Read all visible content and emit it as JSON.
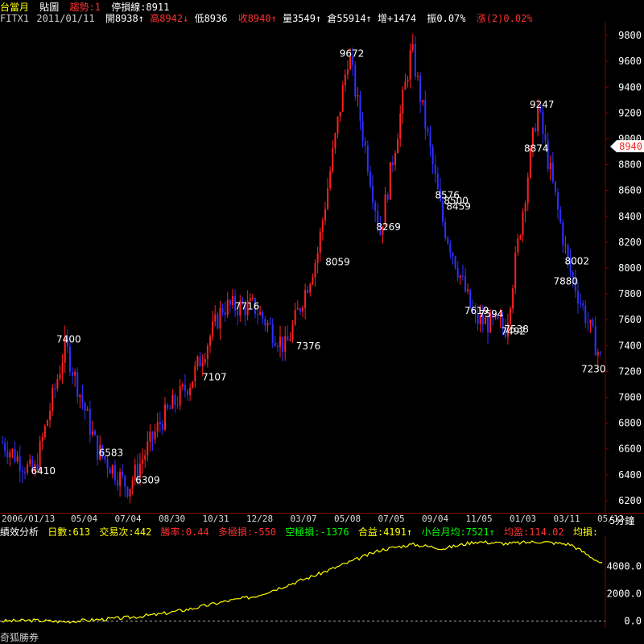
{
  "header": {
    "title": "台當月",
    "tab_chart": "貼圖",
    "trend": "趨勢:1",
    "stop": "停損線:8911"
  },
  "quote": {
    "symbol": "FITX1",
    "date": "2011/01/11",
    "open": "開8938↑",
    "high": "高8942↓",
    "low": "低8936",
    "close": "收8940↑",
    "volume": "量3549↑",
    "oi": "倉55914↑",
    "oi_change": "增+1474",
    "amplitude": "振0.07%",
    "change": "漲(2)0.02%"
  },
  "colors": {
    "up": "#ff2020",
    "down": "#3030ff",
    "yellow": "#ffff00",
    "green": "#00ff00",
    "red_label": "#ff3030",
    "axis": "#8b0000"
  },
  "price_axis": {
    "ticks": [
      "9800",
      "9600",
      "9400",
      "9200",
      "9000",
      "8800",
      "8600",
      "8400",
      "8200",
      "8000",
      "7800",
      "7600",
      "7400",
      "7200",
      "7000",
      "6800",
      "6600",
      "6400",
      "6200"
    ],
    "current_marker": "8940"
  },
  "timeframe": "5分鐘",
  "date_axis": [
    "2006/01/13",
    "05/04",
    "07/04",
    "08/30",
    "10/31",
    "12/28",
    "03/07",
    "05/08",
    "07/05",
    "09/04",
    "11/05",
    "01/03",
    "03/11",
    "05/12"
  ],
  "performance": {
    "label": "績效分析",
    "days": "日數:613",
    "trades": "交易次:442",
    "win_rate": "勝率:0.44",
    "long_loss": "多極損:-550",
    "short_loss": "空極損:-1376",
    "total_profit": "合益:4191↑",
    "mini_avg": "小台月均:7521↑",
    "avg_profit": "均盈:114.02",
    "avg_loss": "均損:"
  },
  "equity_axis": [
    "4000.0",
    "2000.0",
    "0.0"
  ],
  "footer": {
    "brand": "奇狐勝券"
  },
  "chart_data": [
    {
      "type": "line",
      "title": "",
      "xlabel": "",
      "ylabel": "",
      "ylim": [
        6100,
        9900
      ],
      "x": [
        "2006/01/13",
        "05/04",
        "07/04",
        "08/30",
        "10/31",
        "12/28",
        "03/07",
        "05/08",
        "07/05",
        "09/04",
        "11/05",
        "01/03",
        "03/11",
        "05/12",
        ""
      ],
      "series": [
        {
          "values": [
            6650,
            6400,
            7400,
            6600,
            6300,
            6800,
            7130,
            7700,
            7700,
            7380,
            8100,
            9670,
            8270,
            9700,
            8350,
            7600,
            7540,
            9250,
            8000,
            7300
          ]
        }
      ],
      "annotations": [
        "7400",
        "6410",
        "6583",
        "6309",
        "7376",
        "9672",
        "8269",
        "8500",
        "8059",
        "8874",
        "9247",
        "7538",
        "7594",
        "7880",
        "8576",
        "8002",
        "8459",
        "7716",
        "7619",
        "7492",
        "7230",
        "7107"
      ]
    },
    {
      "type": "line",
      "title": "",
      "ylim": [
        -500,
        6200
      ],
      "series": [
        {
          "values": [
            0,
            50,
            -50,
            100,
            250,
            500,
            900,
            1400,
            1800,
            2600,
            3400,
            4300,
            5200,
            5600,
            5300,
            5800,
            5650,
            5800,
            5600,
            4191
          ]
        }
      ]
    }
  ]
}
